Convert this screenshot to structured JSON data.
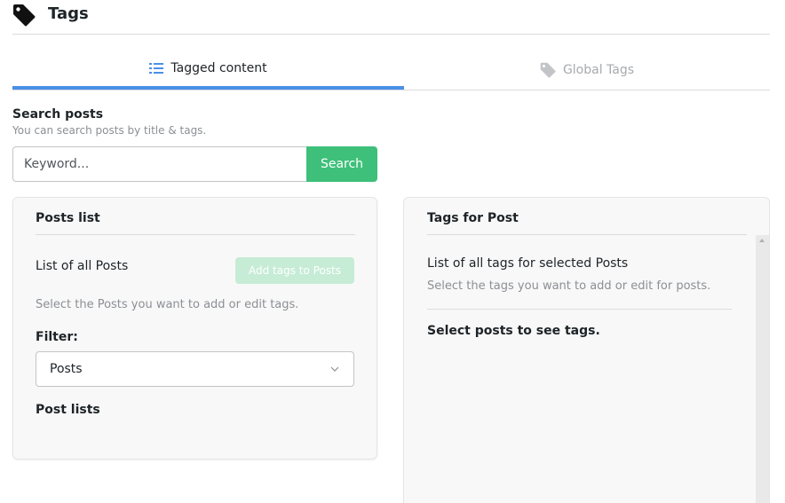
{
  "header": {
    "title": "Tags",
    "icon": "tag-icon"
  },
  "tabs": [
    {
      "label": "Tagged content",
      "icon": "list-icon",
      "active": true
    },
    {
      "label": "Global Tags",
      "icon": "tag-icon",
      "active": false
    }
  ],
  "search": {
    "title": "Search posts",
    "subtitle": "You can search posts by title & tags.",
    "placeholder": "Keyword...",
    "button_label": "Search"
  },
  "posts_panel": {
    "title": "Posts list",
    "list_label": "List of all Posts",
    "add_button_label": "Add tags to Posts",
    "hint": "Select the Posts you want to add or edit tags.",
    "filter_label": "Filter:",
    "filter_value": "Posts",
    "post_lists_label": "Post lists"
  },
  "tags_panel": {
    "title": "Tags for Post",
    "list_label": "List of all tags for selected Posts",
    "hint": "Select the tags you want to add or edit for posts.",
    "empty_message": "Select posts to see tags."
  },
  "colors": {
    "accent_blue": "#4a8fe7",
    "search_green": "#3ec07a",
    "disabled_green": "#c6ecd6"
  }
}
